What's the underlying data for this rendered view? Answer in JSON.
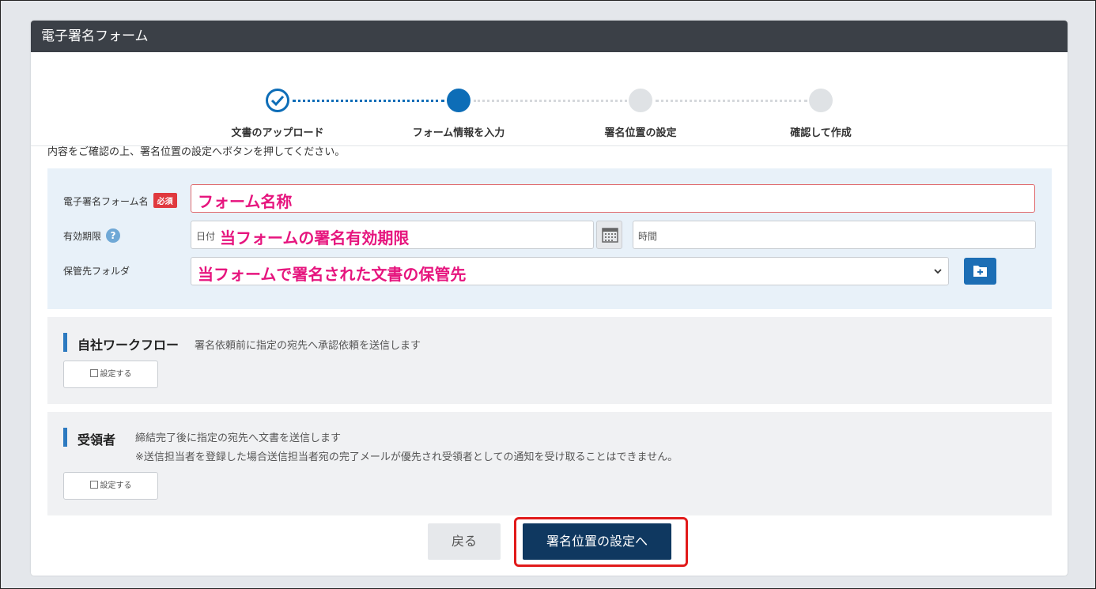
{
  "header": {
    "title": "電子署名フォーム"
  },
  "stepper": {
    "steps": [
      {
        "label": "文書のアップロード",
        "status": "completed"
      },
      {
        "label": "フォーム情報を入力",
        "status": "active"
      },
      {
        "label": "署名位置の設定",
        "status": "pending"
      },
      {
        "label": "確認して作成",
        "status": "pending"
      }
    ]
  },
  "instruction": "内容をご確認の上、署名位置の設定へボタンを押してください。",
  "form": {
    "name_label": "電子署名フォーム名",
    "required_badge": "必須",
    "name_value": "フォーム名称",
    "expiry_label": "有効期限",
    "help_icon": "?",
    "date_placeholder": "日付",
    "date_value": "当フォームの署名有効期限",
    "time_placeholder": "時間",
    "folder_label": "保管先フォルダ",
    "folder_value": "当フォームで署名された文書の保管先"
  },
  "workflow": {
    "title": "自社ワークフロー",
    "description": "署名依頼前に指定の宛先へ承認依頼を送信します",
    "button": "設定する"
  },
  "recipient": {
    "title": "受領者",
    "description": "締結完了後に指定の宛先へ文書を送信します",
    "note": "※送信担当者を登録した場合送信担当者宛の完了メールが優先され受領者としての通知を受け取ることはできません。",
    "button": "設定する"
  },
  "footer": {
    "back": "戻る",
    "next": "署名位置の設定へ"
  },
  "colors": {
    "header_bg": "#3b4047",
    "accent": "#0d6db7",
    "primary_button": "#0f3860",
    "annotation": "#e6157e",
    "highlight_border": "#e11a1a",
    "required": "#e0393e"
  }
}
